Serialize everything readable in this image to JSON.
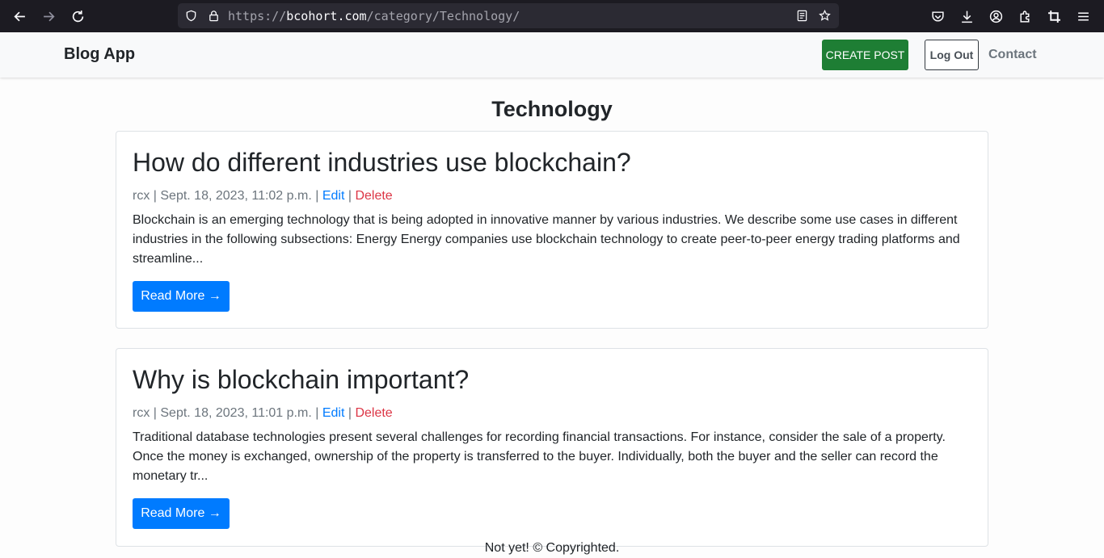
{
  "browser": {
    "url_scheme": "https://",
    "url_domain": "bcohort.com",
    "url_path": "/category/Technology/"
  },
  "navbar": {
    "brand": "Blog App",
    "create_post": "CREATE POST",
    "log_out": "Log Out",
    "contact": "Contact"
  },
  "page": {
    "title": "Technology"
  },
  "posts": [
    {
      "title": "How do different industries use blockchain?",
      "author": "rcx",
      "date": "Sept. 18, 2023, 11:02 p.m.",
      "edit": "Edit",
      "delete": "Delete",
      "excerpt": "Blockchain is an emerging technology that is being adopted in innovative manner by various industries. We describe some use cases in different industries in the following subsections: Energy Energy companies use blockchain technology to create peer-to-peer energy trading platforms and streamline...",
      "read_more": "Read More →"
    },
    {
      "title": "Why is blockchain important?",
      "author": "rcx",
      "date": "Sept. 18, 2023, 11:01 p.m.",
      "edit": "Edit",
      "delete": "Delete",
      "excerpt": "Traditional database technologies present several challenges for recording financial transactions. For instance, consider the sale of a property. Once the money is exchanged, ownership of the property is transferred to the buyer. Individually, both the buyer and the seller can record the monetary tr...",
      "read_more": "Read More →"
    }
  ],
  "footer": {
    "text": "Not yet! © Copyrighted."
  },
  "colors": {
    "create_post": "#1e7e34",
    "primary": "#007bff",
    "danger": "#dc3545"
  }
}
